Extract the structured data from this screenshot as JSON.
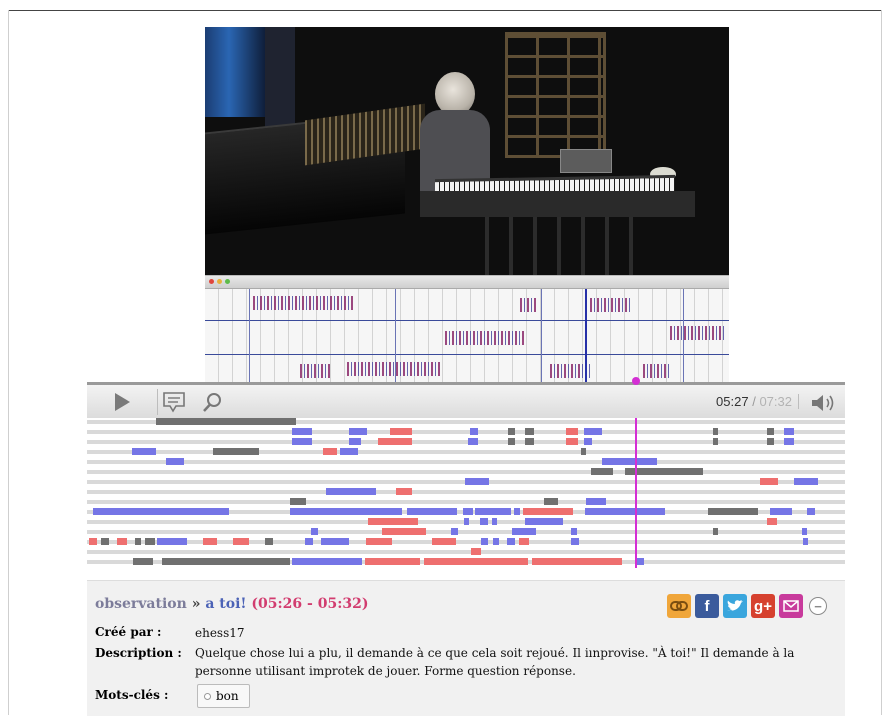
{
  "player": {
    "current_time": "05:27",
    "separator": "/",
    "total_time": "07:32"
  },
  "annotation": {
    "category": "observation",
    "breadcrumb_sep": "»",
    "name": "a toi!",
    "range": "(05:26 - 05:32)",
    "created_by_label": "Créé par :",
    "created_by": "ehess17",
    "description_label": "Description :",
    "description": "Quelque chose lui a plu, il demande à ce que cela soit rejoué. Il iınprovise. \"À toi!\" Il demande à la personne utilisant improtek de jouer. Forme question réponse.",
    "keywords_label": "Mots-clés :",
    "keywords": [
      "bon"
    ]
  },
  "share": {
    "facebook_glyph": "f",
    "gplus_glyph": "g+",
    "minus_glyph": "−"
  },
  "colors": {
    "blue_annotation": "#7575e6",
    "red_annotation": "#ee6f6f",
    "gray_annotation": "#707070",
    "playhead": "#d42fd4"
  },
  "icons": [
    "play-icon",
    "comment-icon",
    "search-icon",
    "volume-icon",
    "link-icon",
    "facebook-icon",
    "twitter-icon",
    "google-plus-icon",
    "email-icon",
    "minus-circle-icon",
    "tag-icon"
  ]
}
